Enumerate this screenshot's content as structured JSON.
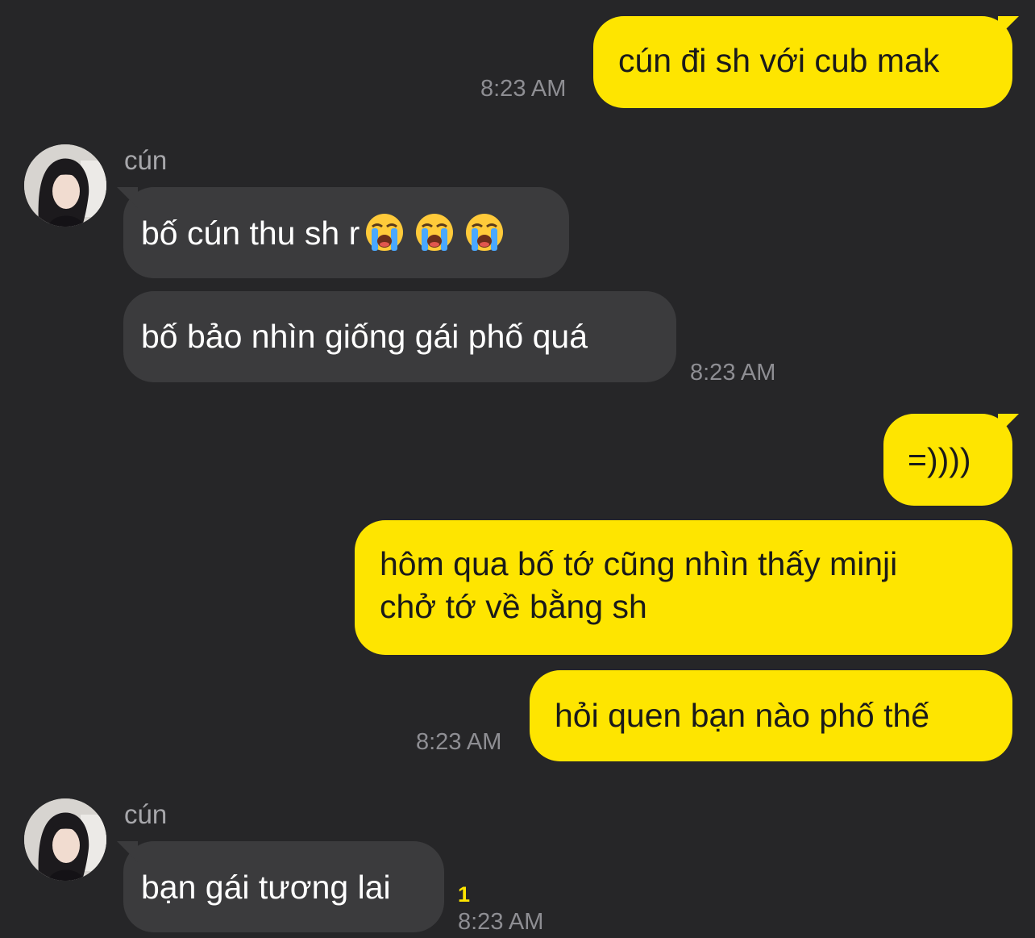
{
  "theme": {
    "my_bubble_color": "#FEE500",
    "their_bubble_color": "#3B3B3D",
    "background": "#262628",
    "unread_color": "#FEE500"
  },
  "messages": {
    "m1": {
      "text": "cún đi sh với cub mak",
      "time": "8:23 AM"
    },
    "g1": {
      "sender": "cún",
      "avatar_icon": "profile-photo",
      "b1": {
        "text": "bố cún thu sh r",
        "emojis": [
          "loudly-crying-face",
          "loudly-crying-face",
          "loudly-crying-face"
        ]
      },
      "b2": {
        "text": "bố bảo nhìn giống gái phố quá"
      },
      "time": "8:23 AM"
    },
    "m2": {
      "text": "=))))"
    },
    "m3": {
      "line1": "hôm qua bố tớ cũng nhìn thấy minji",
      "line2": "chở tớ về bằng sh"
    },
    "m4": {
      "text": "hỏi quen bạn nào phố thế",
      "time": "8:23 AM"
    },
    "g2": {
      "sender": "cún",
      "avatar_icon": "profile-photo",
      "b1": {
        "text": "bạn gái tương lai"
      },
      "unread": "1",
      "time": "8:23 AM"
    }
  }
}
